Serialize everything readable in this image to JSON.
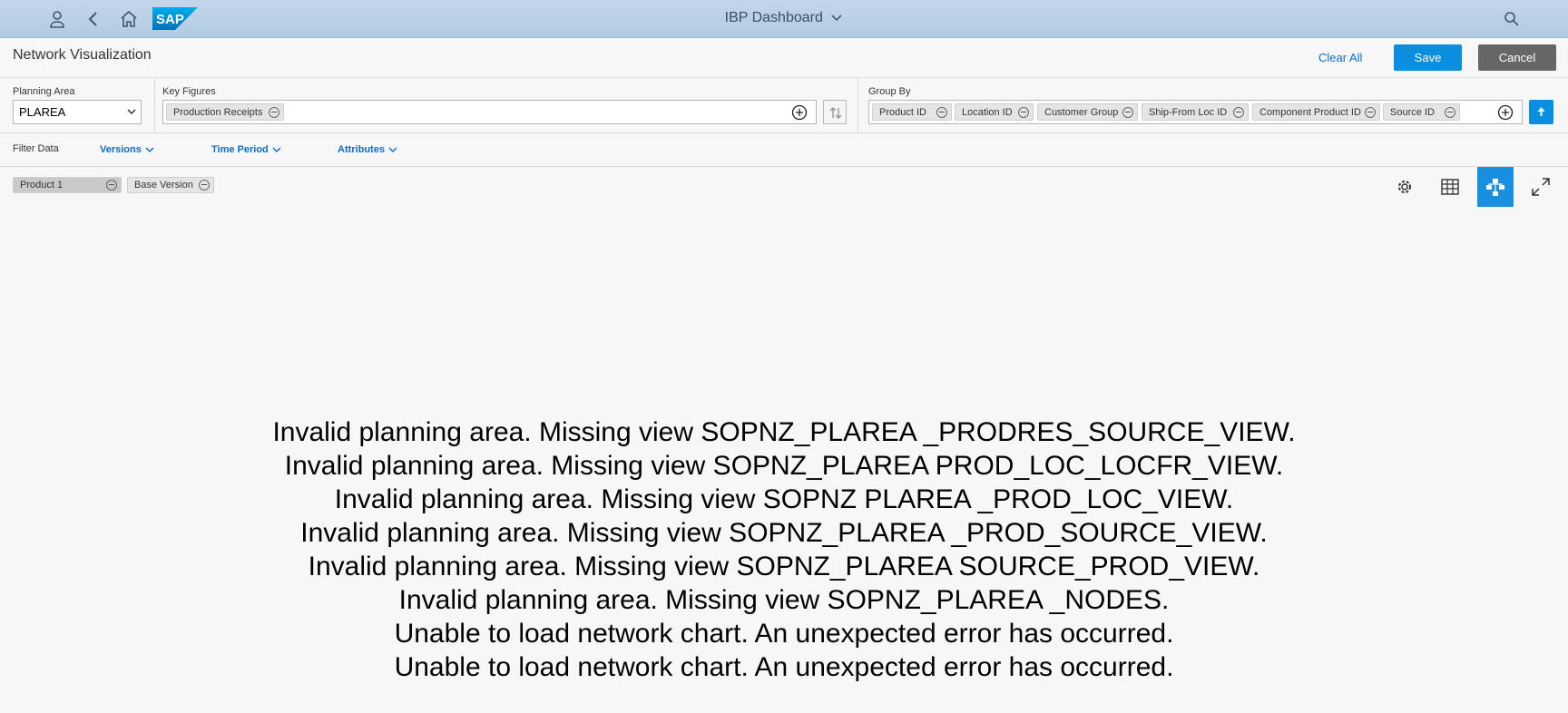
{
  "shell": {
    "title": "IBP Dashboard",
    "icons": [
      "user-icon",
      "back-icon",
      "home-icon",
      "sap-logo",
      "search-icon"
    ],
    "logo_text": "SAP"
  },
  "page": {
    "title": "Network Visualization",
    "clear_all": "Clear All",
    "save": "Save",
    "cancel": "Cancel"
  },
  "selection": {
    "planning_area_label": "Planning Area",
    "planning_area_value": "PLAREA",
    "key_figures_label": "Key Figures",
    "key_figures": [
      "Production Receipts"
    ],
    "group_by_label": "Group By",
    "group_by": [
      "Product ID",
      "Location ID",
      "Customer Group",
      "Ship-From Loc ID",
      "Component Product ID",
      "Source ID"
    ]
  },
  "filter": {
    "label": "Filter Data",
    "versions": "Versions",
    "time_period": "Time Period",
    "attributes": "Attributes"
  },
  "chips": [
    "Product 1",
    "Base Version"
  ],
  "messages": [
    "Invalid planning area. Missing view SOPNZ_PLAREA _PRODRES_SOURCE_VIEW.",
    "Invalid planning area. Missing view SOPNZ_PLAREA PROD_LOC_LOCFR_VIEW.",
    "Invalid planning area. Missing view SOPNZ PLAREA _PROD_LOC_VIEW.",
    "Invalid planning area. Missing view SOPNZ_PLAREA _PROD_SOURCE_VIEW.",
    "Invalid planning area. Missing view SOPNZ_PLAREA SOURCE_PROD_VIEW.",
    "Invalid planning area. Missing view SOPNZ_PLAREA _NODES.",
    "Unable to load network chart. An unexpected error has occurred.",
    "Unable to load network chart. An unexpected error has occurred."
  ],
  "colors": {
    "accent": "#0a8fe0",
    "link": "#0a6ed1",
    "shell": "#b8cfe5",
    "cancel": "#666666"
  }
}
